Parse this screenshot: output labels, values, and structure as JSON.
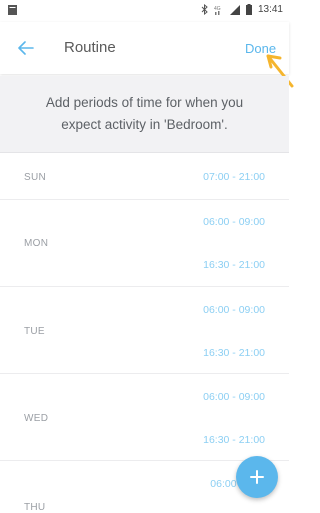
{
  "status_bar": {
    "time": "13:41",
    "icons": [
      "notification-icon",
      "bluetooth-icon",
      "signal-icon",
      "battery-icon"
    ]
  },
  "header": {
    "back_icon": "arrow-left-icon",
    "title": "Routine",
    "done_label": "Done"
  },
  "banner": {
    "line1": "Add periods of time for when you",
    "line2": "expect activity in 'Bedroom'."
  },
  "days": [
    {
      "label": "SUN",
      "slots": [
        "07:00 - 21:00"
      ]
    },
    {
      "label": "MON",
      "slots": [
        "06:00 - 09:00",
        "16:30 - 21:00"
      ]
    },
    {
      "label": "TUE",
      "slots": [
        "06:00 - 09:00",
        "16:30 - 21:00"
      ]
    },
    {
      "label": "WED",
      "slots": [
        "06:00 - 09:00",
        "16:30 - 21:00"
      ]
    },
    {
      "label": "THU",
      "slots": [
        "06:00 -"
      ]
    }
  ],
  "fab": {
    "icon": "plus-icon",
    "label": "+"
  },
  "colors": {
    "accent": "#5bb7ec",
    "slot_text": "#8ccff3",
    "banner_bg": "#f2f2f4",
    "pointer": "#f5b52e"
  }
}
